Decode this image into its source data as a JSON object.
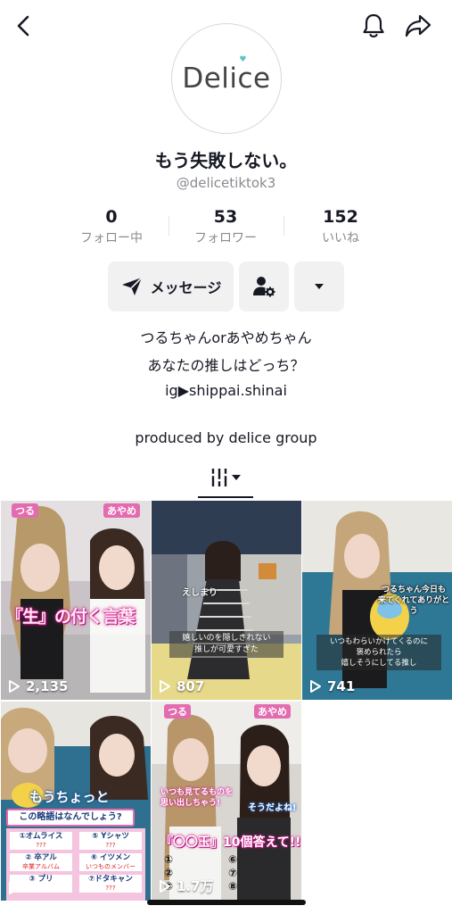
{
  "header": {
    "back_icon": "chevron-left-icon",
    "bell_icon": "bell-icon",
    "share_icon": "share-arrow-icon"
  },
  "profile": {
    "avatar_text": "Delice",
    "name": "もう失敗しない。",
    "handle": "@delicetiktok3"
  },
  "stats": [
    {
      "value": "0",
      "label": "フォロー中"
    },
    {
      "value": "53",
      "label": "フォロワー"
    },
    {
      "value": "152",
      "label": "いいね"
    }
  ],
  "actions": {
    "message_label": "メッセージ"
  },
  "bio": {
    "line1": "つるちゃんorあやめちゃん",
    "line2": "あなたの推しはどっち？",
    "line3": "ig▶shippai.shinai",
    "line4": "produced by delice group"
  },
  "videos": [
    {
      "views": "2,135",
      "tag_left": "つる",
      "tag_right": "あやめ",
      "caption": "『生』の付く言葉"
    },
    {
      "views": "807",
      "tag_left": "えしまり",
      "caption_l1": "嬉しいのを隠しきれない",
      "caption_l2": "推しが可愛すぎた"
    },
    {
      "views": "741",
      "bubble_l1": "つるちゃん今日も",
      "bubble_l2": "来てくれてありがとう",
      "caption_l1": "いつもわらいかけてくるのに",
      "caption_l2": "褒められたら",
      "caption_l3": "嬉しそうにしてる推し"
    },
    {
      "views": "",
      "title": "もうちょっと",
      "question": "この略語はなんでしょう?",
      "items": [
        {
          "n": "①オムライス",
          "a": "???"
        },
        {
          "n": "⑤ Yシャツ",
          "a": "???"
        },
        {
          "n": "② 卒アル",
          "a": "卒業アルバム"
        },
        {
          "n": "⑥ イツメン",
          "a": "いつものメンバー"
        },
        {
          "n": "③ プリ",
          "a": ""
        },
        {
          "n": "⑦ドタキャン",
          "a": "???"
        }
      ]
    },
    {
      "views": "1.7万",
      "tag_left": "つる",
      "tag_right": "あやめ",
      "caption_l1": "いつも見てるものを",
      "caption_l2": "思い出しちゃう!",
      "caption_l3": "そうだよね!",
      "title": "『〇〇玉』10個答えて!!",
      "nums_left": [
        "①",
        "②",
        "③"
      ],
      "nums_right": [
        "⑥",
        "⑦",
        "⑧"
      ]
    }
  ]
}
